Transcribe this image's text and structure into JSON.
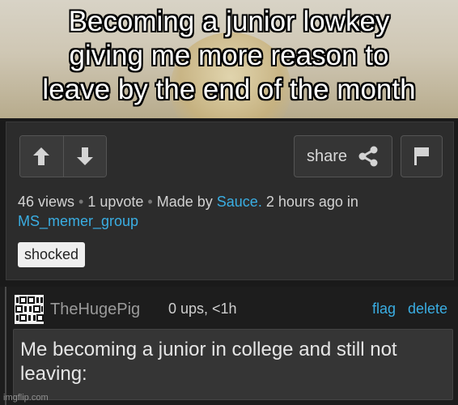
{
  "caption": {
    "line1": "Becoming a junior lowkey",
    "line2": "giving me more reason to",
    "line3": "leave by the end of the month"
  },
  "post": {
    "share_label": "share",
    "views": "46 views",
    "upvotes": "1 upvote",
    "made_by_prefix": "Made by",
    "author": "Sauce.",
    "time_prefix": "2 hours ago in",
    "stream": "MS_memer_group",
    "tag": "shocked"
  },
  "comment": {
    "username": "TheHugePig",
    "meta": "0 ups, <1h",
    "flag_label": "flag",
    "delete_label": "delete",
    "text": "Me becoming a junior in college and still not leaving:"
  },
  "watermark": "imgflip.com",
  "colors": {
    "link": "#3aaee3",
    "panel": "#2c2c2c",
    "caption_text": "#ffffff"
  },
  "icons": [
    "arrow-up-icon",
    "arrow-down-icon",
    "share-icon",
    "flag-icon"
  ]
}
